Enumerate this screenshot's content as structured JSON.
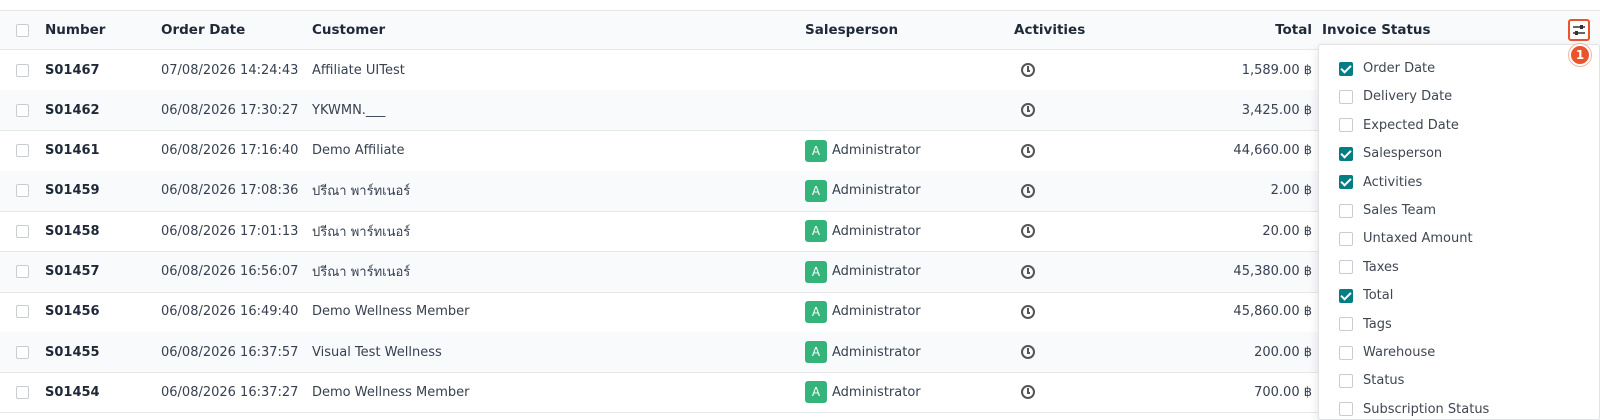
{
  "table": {
    "headers": {
      "number": "Number",
      "order_date": "Order Date",
      "customer": "Customer",
      "salesperson": "Salesperson",
      "activities": "Activities",
      "total": "Total",
      "invoice_status": "Invoice Status"
    },
    "rows": [
      {
        "number": "S01467",
        "date": "07/08/2026 14:24:43",
        "customer": "Affiliate UITest",
        "salesperson": "",
        "avatar": "",
        "total": "1,589.00 ฿"
      },
      {
        "number": "S01462",
        "date": "06/08/2026 17:30:27",
        "customer": "YKWMN.___",
        "salesperson": "",
        "avatar": "",
        "total": "3,425.00 ฿"
      },
      {
        "number": "S01461",
        "date": "06/08/2026 17:16:40",
        "customer": "Demo Affiliate",
        "salesperson": "Administrator",
        "avatar": "A",
        "total": "44,660.00 ฿"
      },
      {
        "number": "S01459",
        "date": "06/08/2026 17:08:36",
        "customer": "ปรีณา พาร์ทเนอร์",
        "salesperson": "Administrator",
        "avatar": "A",
        "total": "2.00 ฿"
      },
      {
        "number": "S01458",
        "date": "06/08/2026 17:01:13",
        "customer": "ปรีณา พาร์ทเนอร์",
        "salesperson": "Administrator",
        "avatar": "A",
        "total": "20.00 ฿"
      },
      {
        "number": "S01457",
        "date": "06/08/2026 16:56:07",
        "customer": "ปรีณา พาร์ทเนอร์",
        "salesperson": "Administrator",
        "avatar": "A",
        "total": "45,380.00 ฿"
      },
      {
        "number": "S01456",
        "date": "06/08/2026 16:49:40",
        "customer": "Demo Wellness Member",
        "salesperson": "Administrator",
        "avatar": "A",
        "total": "45,860.00 ฿"
      },
      {
        "number": "S01455",
        "date": "06/08/2026 16:37:57",
        "customer": "Visual Test Wellness",
        "salesperson": "Administrator",
        "avatar": "A",
        "total": "200.00 ฿"
      },
      {
        "number": "S01454",
        "date": "06/08/2026 16:37:27",
        "customer": "Demo Wellness Member",
        "salesperson": "Administrator",
        "avatar": "A",
        "total": "700.00 ฿"
      }
    ]
  },
  "settings_badge": "1",
  "column_options": [
    {
      "label": "Order Date",
      "checked": true
    },
    {
      "label": "Delivery Date",
      "checked": false
    },
    {
      "label": "Expected Date",
      "checked": false
    },
    {
      "label": "Salesperson",
      "checked": true
    },
    {
      "label": "Activities",
      "checked": true
    },
    {
      "label": "Sales Team",
      "checked": false
    },
    {
      "label": "Untaxed Amount",
      "checked": false
    },
    {
      "label": "Taxes",
      "checked": false
    },
    {
      "label": "Total",
      "checked": true
    },
    {
      "label": "Tags",
      "checked": false
    },
    {
      "label": "Warehouse",
      "checked": false
    },
    {
      "label": "Status",
      "checked": false
    },
    {
      "label": "Subscription Status",
      "checked": false
    }
  ],
  "colors": {
    "accent": "#017e84",
    "highlight": "#e8542b",
    "avatar": "#34b37a"
  }
}
